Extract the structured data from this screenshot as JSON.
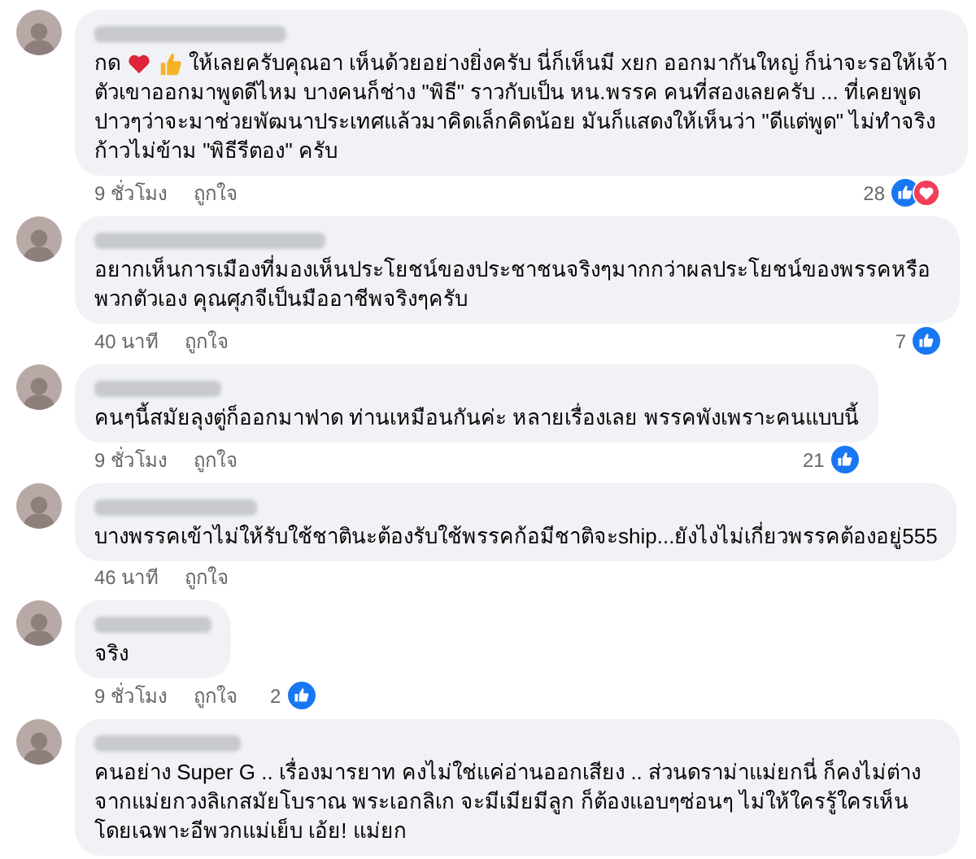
{
  "comments": [
    {
      "prefix": "กด",
      "inline_icons": [
        {
          "kind": "heart"
        },
        {
          "kind": "thumbs_up"
        }
      ],
      "first_line": "ให้เลยครับคุณอา เห็นด้วยอย่างยิ่งครับ นี่ก็เห็นมี xยก ออกมากันใหญ่ ก็น่าจะรอให้เจ้า",
      "text": "ตัวเขาออกมาพูดดีไหม บางคนก็ช่าง \"พิธี\" ราวกับเป็น หน.พรรค คนที่สองเลยครับ ... ที่เคยพูดปาวๆว่าจะมาช่วยพัฒนาประเทศแล้วมาคิดเล็กคิดน้อย มันก็แสดงให้เห็นว่า \"ดีแต่พูด\" ไม่ทำจริง ก้าวไม่ข้าม \"พิธีรีตอง\" ครับ",
      "time": "9 ชั่วโมง",
      "like": "ถูกใจ",
      "reaction_count": "28",
      "reactions": [
        {
          "kind": "like"
        },
        {
          "kind": "love"
        }
      ]
    },
    {
      "text": "อยากเห็นการเมืองที่มองเห็นประโยชน์ของประชาชนจริงๆมากกว่าผลประโยชน์ของพรรคหรือพวกตัวเอง คุณศุภจีเป็นมืออาชีพจริงๆครับ",
      "time": "40 นาที",
      "like": "ถูกใจ",
      "reaction_count": "7",
      "reactions": [
        {
          "kind": "like"
        }
      ]
    },
    {
      "text": "คนๆนี้สมัยลุงตู่ก็ออกมาฟาด ท่านเหมือนกันค่ะ หลายเรื่องเลย พรรคพังเพราะคนแบบนี้",
      "time": "9 ชั่วโมง",
      "like": "ถูกใจ",
      "reaction_count": "21",
      "reactions": [
        {
          "kind": "like"
        }
      ]
    },
    {
      "text": "บางพรรคเข้าไม่ให้รับใช้ชาตินะต้องรับใช้พรรคก้อมีชาติจะship...ยังไงไม่เกี่ยวพรรคต้องอยู่555",
      "time": "46 นาที",
      "like": "ถูกใจ"
    },
    {
      "text": "จริง",
      "time": "9 ชั่วโมง",
      "like": "ถูกใจ",
      "reaction_count": "2",
      "reactions": [
        {
          "kind": "like"
        }
      ]
    },
    {
      "text": "คนอย่าง Super G .. เรื่องมารยาท คงไม่ใช่แค่อ่านออกเสียง .. ส่วนดราม่าแม่ยกนี่ ก็คงไม่ต่างจากแม่ยกวงลิเกสมัยโบราณ พระเอกลิเก จะมีเมียมีลูก ก็ต้องแอบๆซ่อนๆ ไม่ให้ใครรู้ใครเห็น โดยเฉพาะอีพวกแม่เย็บ เอ้ย! แม่ยก"
    }
  ]
}
